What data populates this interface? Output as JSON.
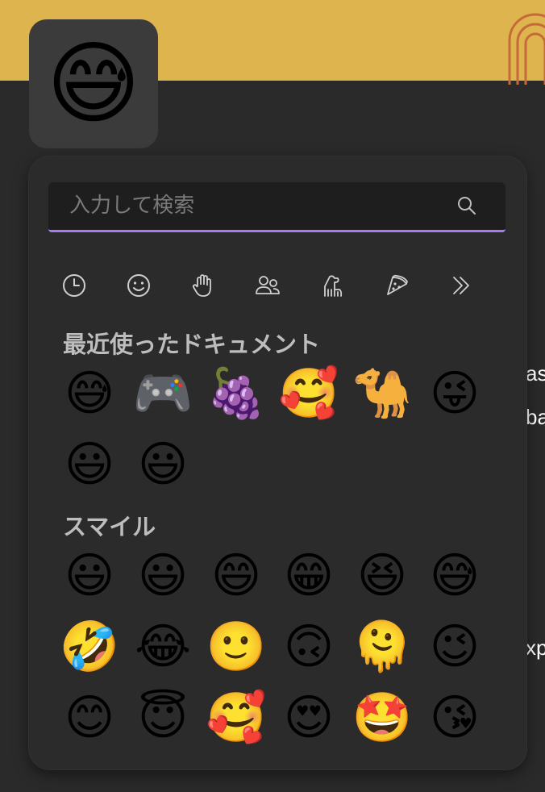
{
  "selected_emoji": "😅",
  "side_text": [
    "as",
    "ba",
    "xp"
  ],
  "search": {
    "placeholder": "入力して検索"
  },
  "categories": [
    {
      "name": "recent",
      "icon": "clock-icon"
    },
    {
      "name": "smileys",
      "icon": "smiley-icon"
    },
    {
      "name": "people",
      "icon": "hand-icon"
    },
    {
      "name": "people-group",
      "icon": "people-icon"
    },
    {
      "name": "animals",
      "icon": "dog-icon"
    },
    {
      "name": "food",
      "icon": "pizza-icon"
    },
    {
      "name": "more",
      "icon": "chevron-double-right-icon"
    }
  ],
  "sections": [
    {
      "title": "最近使ったドキュメント",
      "emojis": [
        "😅",
        "🎮",
        "🍇",
        "🥰",
        "🐪",
        "😜",
        "😃",
        "😃"
      ]
    },
    {
      "title": "スマイル",
      "emojis": [
        "😃",
        "😃",
        "😄",
        "😁",
        "😆",
        "😅",
        "🤣",
        "😂",
        "🙂",
        "🙃",
        "🫠",
        "😉",
        "😊",
        "😇",
        "🥰",
        "😍",
        "🤩",
        "😘"
      ]
    }
  ],
  "colors": {
    "accent": "#a779f4",
    "banner": "#ddb44e",
    "panel": "#2b2b2b"
  }
}
